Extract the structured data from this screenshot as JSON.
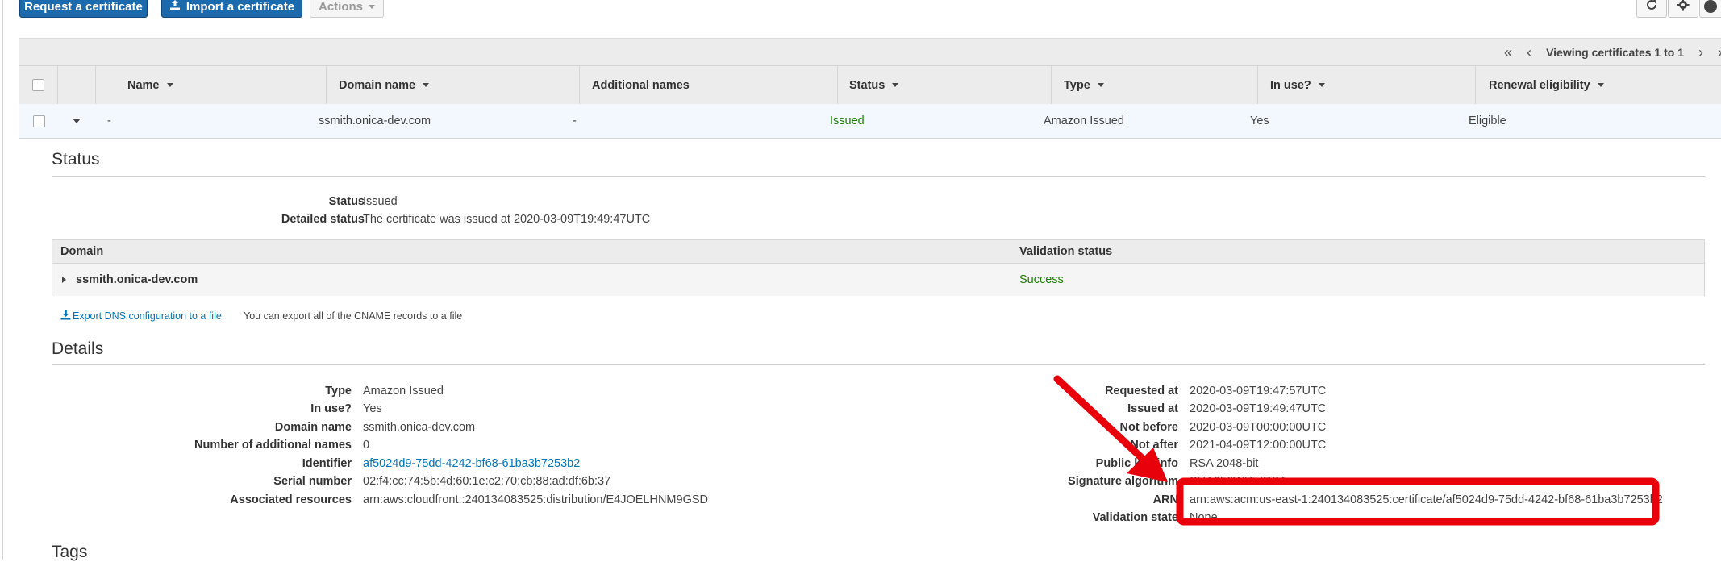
{
  "toolbar": {
    "request_label": "Request a certificate",
    "import_label": "Import a certificate",
    "actions_label": "Actions",
    "refresh_icon": "refresh-icon",
    "settings_icon": "gear-icon",
    "help_icon": "help-icon"
  },
  "pagination": {
    "text": "Viewing certificates 1 to 1",
    "first": "«",
    "prev": "‹",
    "next": "›",
    "last": "»"
  },
  "table": {
    "columns": [
      "Name",
      "Domain name",
      "Additional names",
      "Status",
      "Type",
      "In use?",
      "Renewal eligibility"
    ],
    "row": {
      "name": "-",
      "domain": "ssmith.onica-dev.com",
      "additional": "-",
      "status": "Issued",
      "type": "Amazon Issued",
      "in_use": "Yes",
      "renewal": "Eligible"
    }
  },
  "status_section": {
    "title": "Status",
    "status_label": "Status",
    "status_value": "Issued",
    "detailed_label": "Detailed status",
    "detailed_value": "The certificate was issued at 2020-03-09T19:49:47UTC",
    "domain_table": {
      "col_domain": "Domain",
      "col_validation": "Validation status",
      "domain": "ssmith.onica-dev.com",
      "validation": "Success"
    },
    "export_link": "Export DNS configuration to a file",
    "export_note": "You can export all of the CNAME records to a file"
  },
  "details_section": {
    "title": "Details",
    "left": [
      {
        "label": "Type",
        "value": "Amazon Issued"
      },
      {
        "label": "In use?",
        "value": "Yes"
      },
      {
        "label": "Domain name",
        "value": "ssmith.onica-dev.com"
      },
      {
        "label": "Number of additional names",
        "value": "0"
      },
      {
        "label": "Identifier",
        "value": "af5024d9-75dd-4242-bf68-61ba3b7253b2"
      },
      {
        "label": "Serial number",
        "value": "02:f4:cc:74:5b:4d:60:1e:c2:70:cb:88:ad:df:6b:37"
      },
      {
        "label": "Associated resources",
        "value": "arn:aws:cloudfront::240134083525:distribution/E4JOELHNM9GSD"
      }
    ],
    "right": [
      {
        "label": "Requested at",
        "value": "2020-03-09T19:47:57UTC"
      },
      {
        "label": "Issued at",
        "value": "2020-03-09T19:49:47UTC"
      },
      {
        "label": "Not before",
        "value": "2020-03-09T00:00:00UTC"
      },
      {
        "label": "Not after",
        "value": "2021-04-09T12:00:00UTC"
      },
      {
        "label": "Public key info",
        "value": "RSA 2048-bit"
      },
      {
        "label": "Signature algorithm",
        "value": "SHA256WITHRSA"
      },
      {
        "label": "ARN",
        "value": "arn:aws:acm:us-east-1:240134083525:certificate/af5024d9-75dd-4242-bf68-61ba3b7253b2"
      },
      {
        "label": "Validation state",
        "value": "None"
      }
    ]
  },
  "tags_section": {
    "title": "Tags"
  },
  "annotation_color": "#e8000b"
}
